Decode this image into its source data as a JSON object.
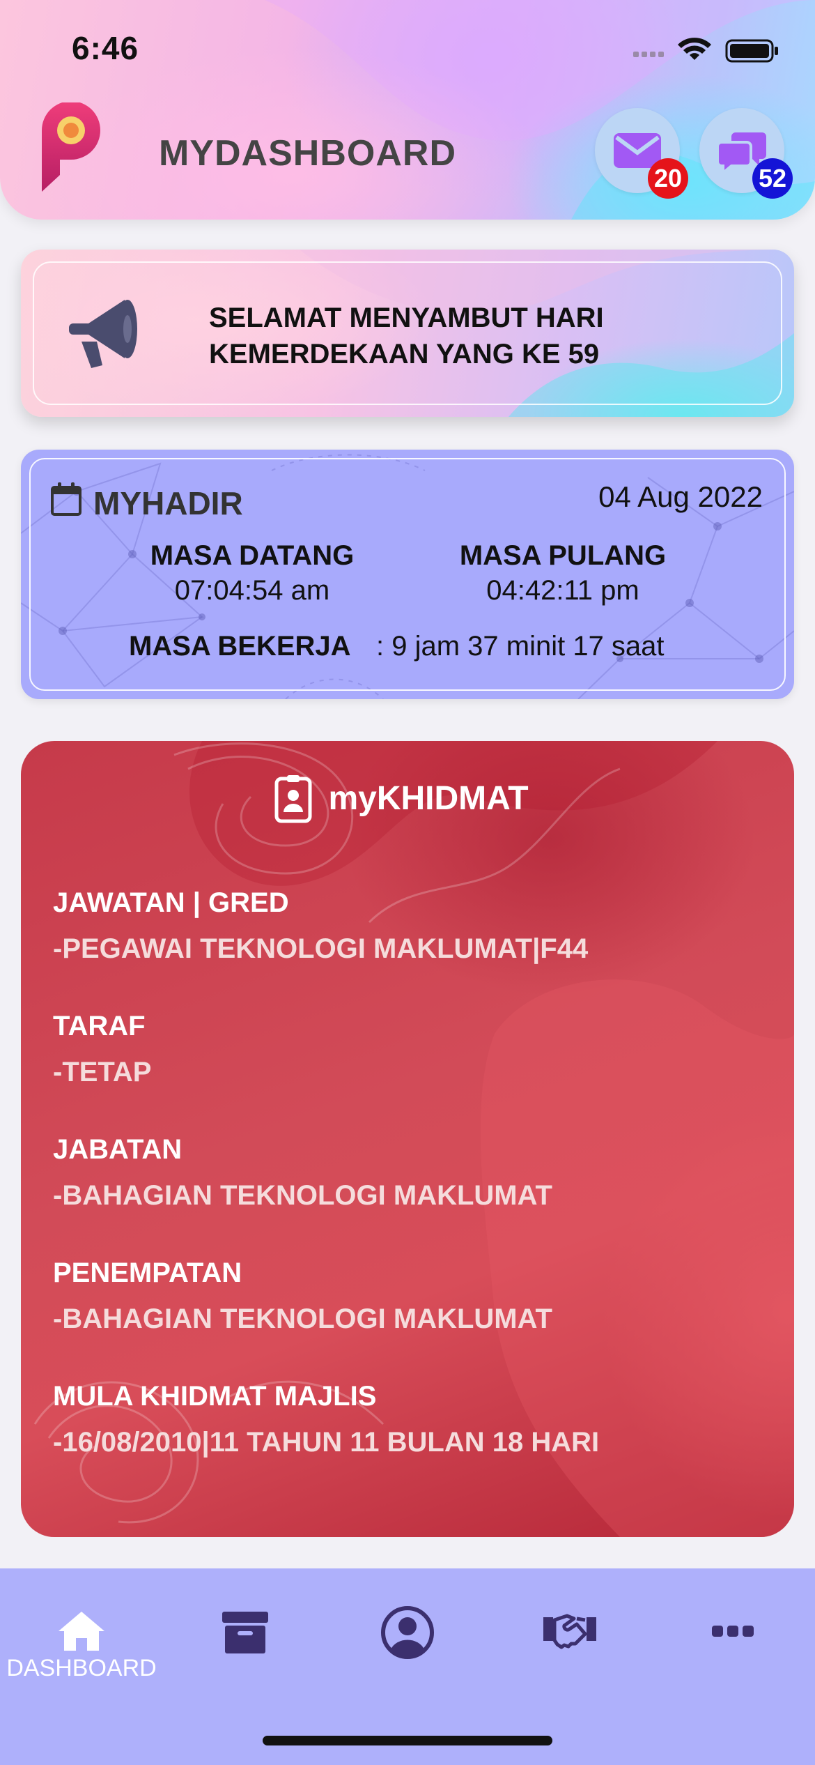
{
  "status_bar": {
    "time": "6:46"
  },
  "header": {
    "app_title": "MYDASHBOARD",
    "mail_badge": "20",
    "chat_badge": "52",
    "colors": {
      "mail_badge": "#e5141a",
      "chat_badge": "#1414d6",
      "icon": "#a259f4"
    }
  },
  "announcement": {
    "line1": "SELAMAT MENYAMBUT HARI",
    "line2": "KEMERDEKAAN YANG KE 59"
  },
  "myhadir": {
    "title": "MYHADIR",
    "date": "04 Aug 2022",
    "masa_datang_label": "MASA DATANG",
    "masa_datang_value": "07:04:54 am",
    "masa_pulang_label": "MASA PULANG",
    "masa_pulang_value": "04:42:11 pm",
    "masa_bekerja_label": "MASA BEKERJA",
    "masa_bekerja_value": ": 9 jam 37 minit 17 saat"
  },
  "mykhidmat": {
    "title": "myKHIDMAT",
    "fields": [
      {
        "label": "JAWATAN | GRED",
        "value": "-PEGAWAI TEKNOLOGI MAKLUMAT|F44"
      },
      {
        "label": "TARAF",
        "value": "-TETAP"
      },
      {
        "label": "JABATAN",
        "value": "-BAHAGIAN TEKNOLOGI MAKLUMAT"
      },
      {
        "label": "PENEMPATAN",
        "value": "-BAHAGIAN TEKNOLOGI MAKLUMAT"
      },
      {
        "label": "MULA KHIDMAT MAJLIS",
        "value": "-16/08/2010|11 TAHUN 11 BULAN 18 HARI"
      }
    ]
  },
  "bottom_nav": {
    "items": [
      {
        "icon": "home-icon",
        "label": "DASHBOARD",
        "active": true
      },
      {
        "icon": "archive-icon",
        "label": ""
      },
      {
        "icon": "profile-icon",
        "label": ""
      },
      {
        "icon": "handshake-icon",
        "label": ""
      },
      {
        "icon": "more-icon",
        "label": ""
      }
    ],
    "colors": {
      "active": "#ffffff",
      "inactive": "#3b2f6e"
    }
  }
}
